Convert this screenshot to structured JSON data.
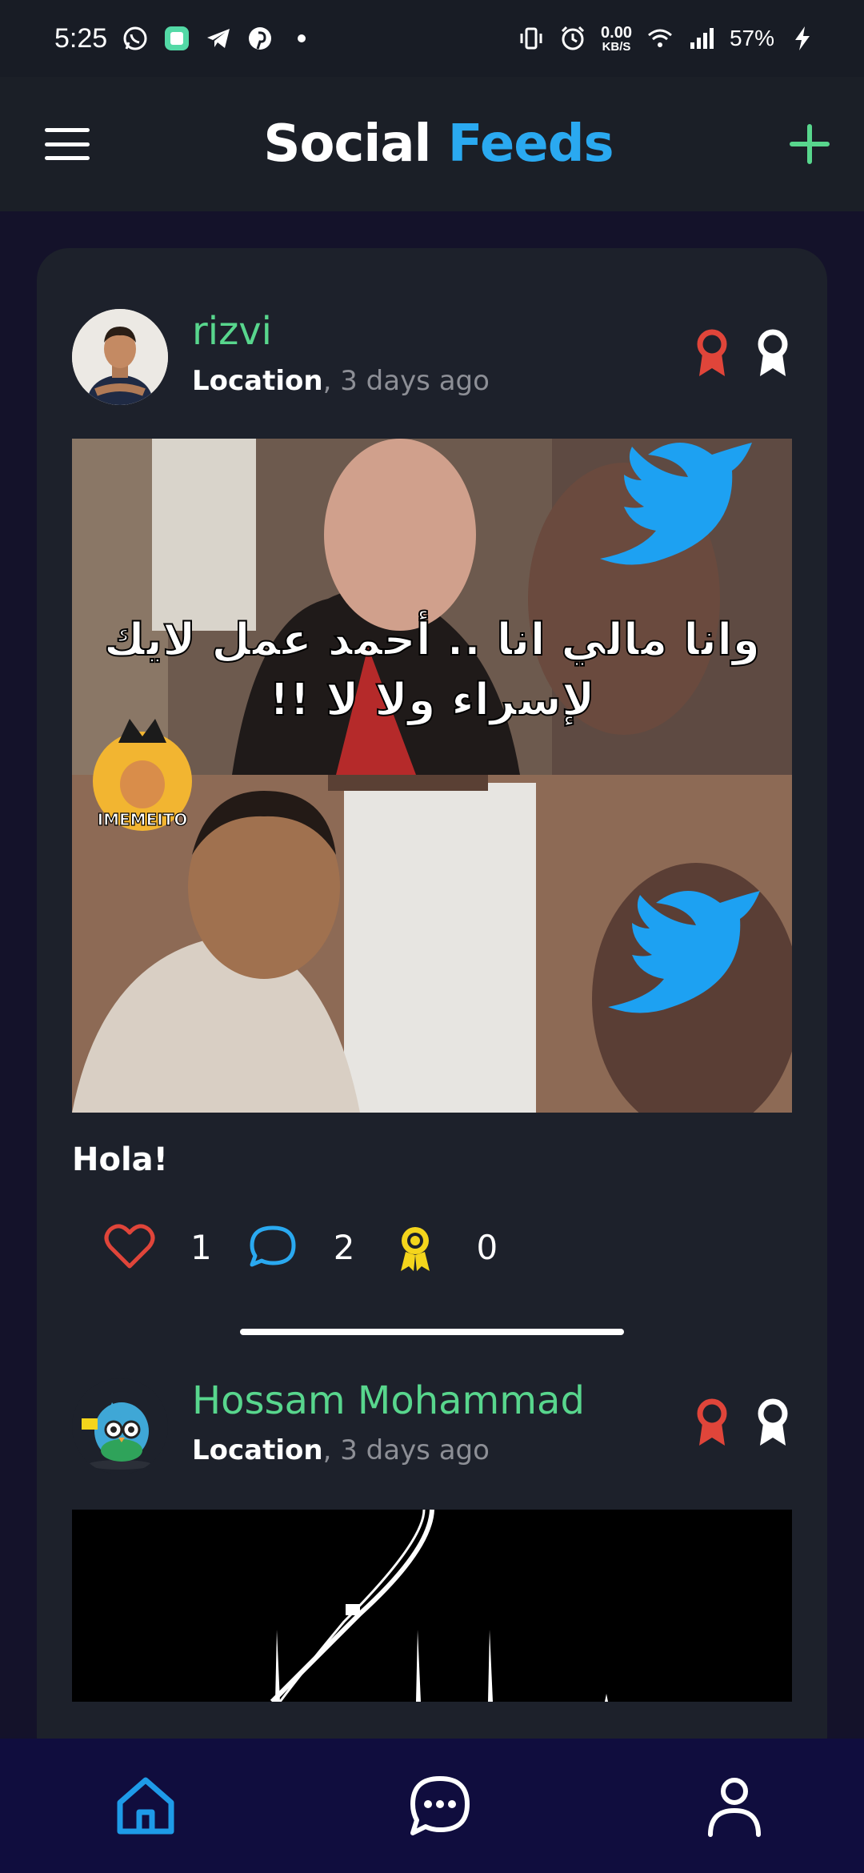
{
  "status_bar": {
    "time": "5:25",
    "net_speed_value": "0.00",
    "net_speed_unit": "KB/S",
    "battery": "57%"
  },
  "header": {
    "title_part1": "Social",
    "title_part2": "Feeds"
  },
  "posts": [
    {
      "user_name": "rizvi",
      "location": "Location",
      "time_ago": ", 3 days ago",
      "image_text_line1": "وانا مالي انا .. أحمد عمل لايك",
      "image_text_line2": "لإسراء ولا لا !!",
      "image_watermark": "IMEMEITO",
      "caption": "Hola!",
      "likes": "1",
      "comments": "2",
      "awards": "0"
    },
    {
      "user_name": "Hossam Mohammad",
      "location": "Location",
      "time_ago": ", 3 days ago"
    }
  ],
  "colors": {
    "accent_blue": "#2aa9f0",
    "accent_green": "#58d68d",
    "like_red": "#e0453a",
    "award_yellow": "#f4d51c",
    "card_bg": "#1d212b",
    "nav_bg": "#100d3e"
  }
}
